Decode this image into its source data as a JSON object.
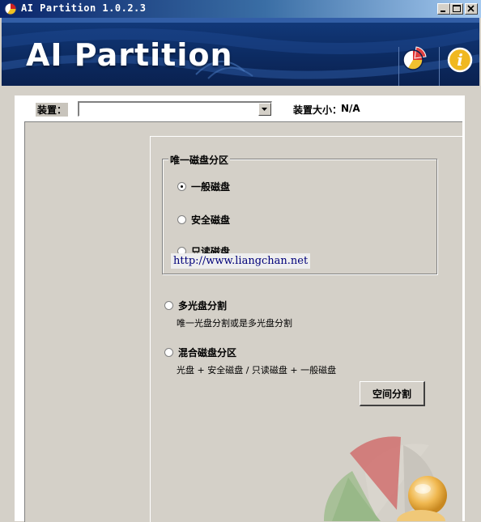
{
  "window": {
    "title": "AI Partition 1.0.2.3",
    "minimize_icon": "minimize-icon",
    "maximize_icon": "maximize-icon",
    "close_icon": "close-icon"
  },
  "banner": {
    "title": "AI Partition",
    "buttons": [
      {
        "icon": "pie-chart-icon"
      },
      {
        "icon": "info-icon"
      }
    ]
  },
  "device": {
    "label": "装置：",
    "selected": "",
    "size_label": "装置大小：",
    "size_value": "N/A"
  },
  "group": {
    "title": "唯一磁盘分区",
    "options": [
      {
        "label": "一般磁盘",
        "checked": true
      },
      {
        "label": "安全磁盘",
        "checked": false
      },
      {
        "label": "只读磁盘",
        "checked": false
      }
    ]
  },
  "watermark_url": "http://www.liangchan.net",
  "options": [
    {
      "label": "多光盘分割",
      "desc": "唯一光盘分割或是多光盘分割"
    },
    {
      "label": "混合磁盘分区",
      "desc": "光盘 + 安全磁盘 / 只读磁盘 + 一般磁盘"
    }
  ],
  "split_button": "空间分割",
  "colors": {
    "banner": "#0c2a60",
    "titlebar_start": "#0a246a",
    "face": "#d4d0c8"
  }
}
